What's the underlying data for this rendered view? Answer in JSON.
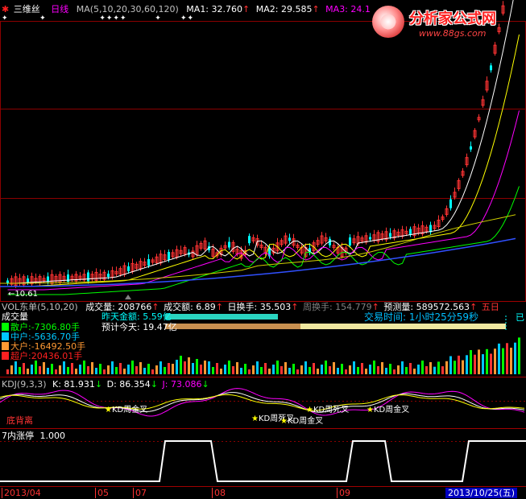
{
  "header": {
    "stock_name": "三维丝",
    "period": "日线",
    "ma_params": "MA(5,10,20,30,60,120)",
    "ma1_label": "MA1: 32.760",
    "ma2_label": "MA2: 29.585",
    "ma3_label": "MA3: 24.1"
  },
  "logo": {
    "title": "分析家公式网",
    "url": "www.88gs.com"
  },
  "price_chart": {
    "low_label": "←10.61"
  },
  "volume_bar": {
    "indicator": "VOL东单(5,10,20)",
    "volume_label": "成交量: 208766",
    "amount_label": "成交额: 6.89",
    "turnover_label": "日换手: 35.503",
    "weekly_turnover_label": "周换手: 154.779",
    "forecast_label": "预测量: 589572.563",
    "weekday": "五日"
  },
  "volume_panel": {
    "title": "成交量",
    "yesterday_amount": "昨天金额: 5.59亿",
    "today_estimate": "预计今天: 19.47亿",
    "trade_time": "交易时间: 1小时25分59秒",
    "side_char": "已",
    "legend": [
      {
        "name": "散户",
        "value": "散户:-7306.80手",
        "color": "#00ff00"
      },
      {
        "name": "中户",
        "value": "中户:-5636.70手",
        "color": "#00c8ff"
      },
      {
        "name": "大户",
        "value": "大户:-16492.50手",
        "color": "#ff9933"
      },
      {
        "name": "超户",
        "value": "超户:20436.01手",
        "color": "#ff2020"
      }
    ]
  },
  "kdj": {
    "title": "KDJ(9,3,3)",
    "k_label": "K: 81.931",
    "d_label": "D: 86.354",
    "j_label": "J: 73.086",
    "bottom_divergence": "底背离",
    "annotations": [
      "KD周金叉",
      "KD周死叉",
      "KD周金叉",
      "KD周死叉",
      "KD周金叉"
    ]
  },
  "limit_panel": {
    "title": "7内涨停",
    "value": "1.000"
  },
  "date_axis": {
    "labels": [
      "2013/04",
      "05",
      "07",
      "08",
      "09"
    ],
    "current_date": "2013/10/25(五)"
  },
  "colors": {
    "up": "#ff3333",
    "down": "#00ffff",
    "ma1": "#ffffff",
    "ma2": "#ffff00",
    "ma3": "#ff00ff"
  }
}
